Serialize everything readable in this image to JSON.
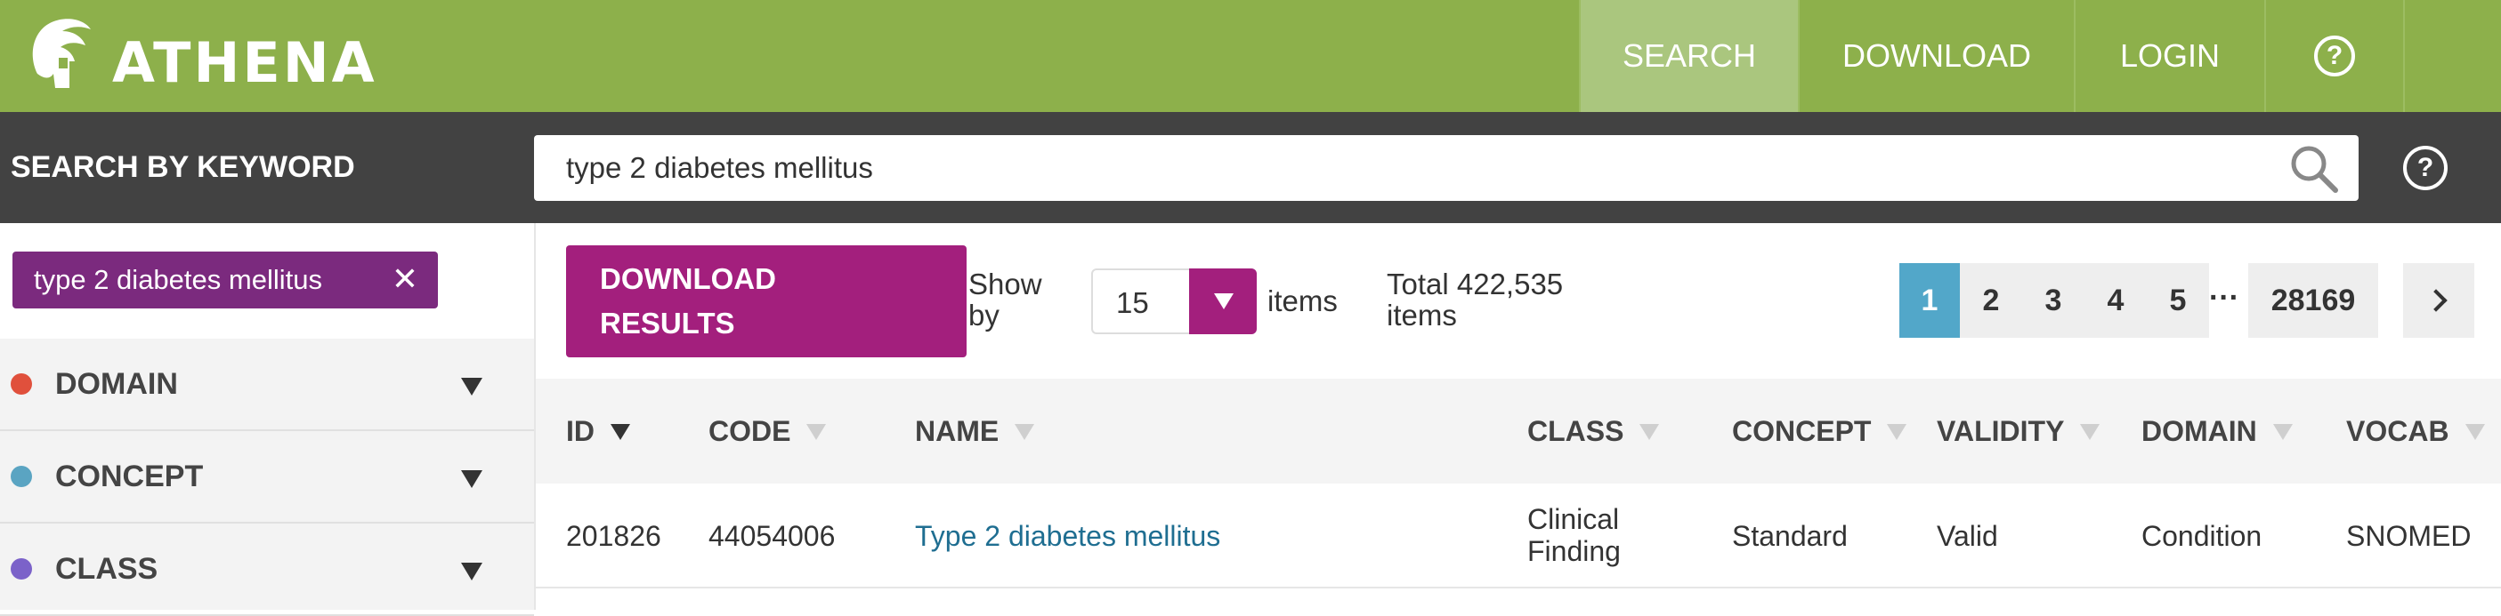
{
  "app": {
    "logo_text": "ATHENA"
  },
  "nav": {
    "search": "SEARCH",
    "download": "DOWNLOAD",
    "login": "LOGIN",
    "help": "?"
  },
  "search": {
    "title": "SEARCH BY KEYWORD",
    "value": "type 2 diabetes mellitus",
    "help": "?"
  },
  "filters": {
    "chip_label": "type 2 diabetes mellitus",
    "chip_close": "✕",
    "facets": [
      {
        "label": "DOMAIN",
        "color": "#e0503c"
      },
      {
        "label": "CONCEPT",
        "color": "#5aa4c2"
      },
      {
        "label": "CLASS",
        "color": "#7b62c9"
      }
    ]
  },
  "toolbar": {
    "download_line1": "DOWNLOAD",
    "download_line2": "RESULTS",
    "show_by_line1": "Show",
    "show_by_line2": "by",
    "page_size": "15",
    "items_label": "items",
    "total_line1": "Total 422,535",
    "total_line2": "items"
  },
  "pagination": {
    "pages": [
      "1",
      "2",
      "3",
      "4",
      "5"
    ],
    "active": "1",
    "ellipsis": "···",
    "last": "28169"
  },
  "table": {
    "columns": [
      "ID",
      "CODE",
      "NAME",
      "CLASS",
      "CONCEPT",
      "VALIDITY",
      "DOMAIN",
      "VOCAB"
    ],
    "sorted_column": "ID",
    "rows": [
      {
        "id": "201826",
        "code": "44054006",
        "name": "Type 2 diabetes mellitus",
        "class_line1": "Clinical",
        "class_line2": "Finding",
        "concept": "Standard",
        "validity": "Valid",
        "domain": "Condition",
        "vocab": "SNOMED"
      }
    ]
  },
  "colors": {
    "topbar": "#8db04b",
    "nav_active": "#aac67e",
    "searchbar": "#424242",
    "chip": "#7b2a7e",
    "primary_button": "#a31f7d",
    "page_active": "#52a7c9",
    "link": "#1f6e91"
  }
}
